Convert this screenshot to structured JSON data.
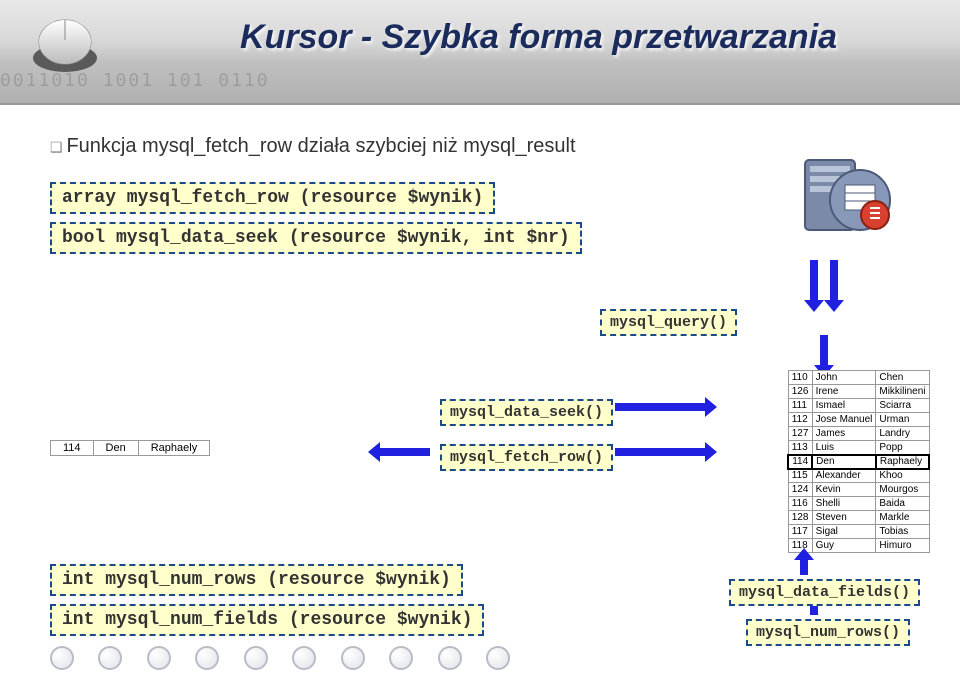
{
  "header": {
    "title": "Kursor - Szybka forma przetwarzania",
    "binary_decoration": "0011010 1001 101 0110"
  },
  "body": {
    "bullet": "Funkcja mysql_fetch_row działa szybciej niż mysql_result",
    "sig1": "array mysql_fetch_row (resource $wynik)",
    "sig2": "bool mysql_data_seek (resource $wynik, int $nr)"
  },
  "labels": {
    "query": "mysql_query()",
    "data_seek": "mysql_data_seek()",
    "fetch_row": "mysql_fetch_row()",
    "data_fields": "mysql_data_fields()",
    "num_rows": "mysql_num_rows()"
  },
  "bottom": {
    "sig3": "int mysql_num_rows (resource $wynik)",
    "sig4": "int mysql_num_fields (resource $wynik)"
  },
  "single_row": {
    "c1": "114",
    "c2": "Den",
    "c3": "Raphaely"
  },
  "big_table": [
    [
      "110",
      "John",
      "Chen"
    ],
    [
      "126",
      "Irene",
      "Mikkilineni"
    ],
    [
      "111",
      "Ismael",
      "Sciarra"
    ],
    [
      "112",
      "Jose Manuel",
      "Urman"
    ],
    [
      "127",
      "James",
      "Landry"
    ],
    [
      "113",
      "Luis",
      "Popp"
    ],
    [
      "114",
      "Den",
      "Raphaely"
    ],
    [
      "115",
      "Alexander",
      "Khoo"
    ],
    [
      "124",
      "Kevin",
      "Mourgos"
    ],
    [
      "116",
      "Shelli",
      "Baida"
    ],
    [
      "128",
      "Steven",
      "Markle"
    ],
    [
      "117",
      "Sigal",
      "Tobias"
    ],
    [
      "118",
      "Guy",
      "Himuro"
    ]
  ]
}
